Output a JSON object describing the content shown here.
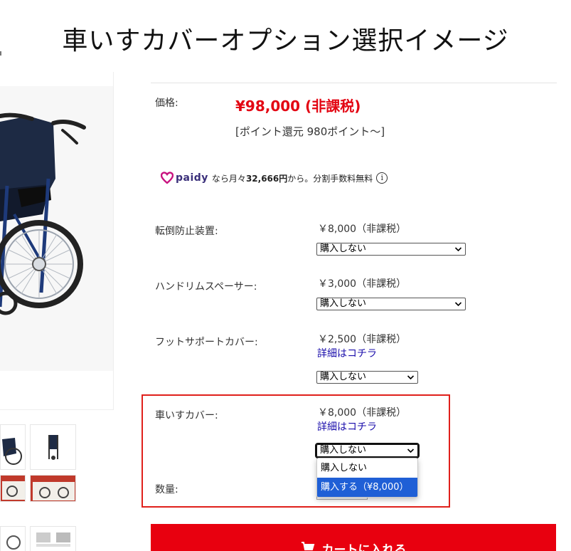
{
  "page": {
    "title": "車いすカバーオプション選択イメージ"
  },
  "product": {
    "price_label": "価格:",
    "price_value": "¥98,000 (非課税)",
    "points_text": "[ポイント還元 980ポイント〜]"
  },
  "paidy": {
    "brand": "paidy",
    "text_prefix": "なら月々",
    "monthly_amount": "32,666円",
    "text_suffix": "から。分割手数料無料",
    "info_symbol": "i"
  },
  "options": [
    {
      "label": "転倒防止装置:",
      "price": "￥8,000（非課税）",
      "select_value": "購入しない"
    },
    {
      "label": "ハンドリムスペーサー:",
      "price": "￥3,000（非課税）",
      "select_value": "購入しない"
    },
    {
      "label": "フットサポートカバー:",
      "price": "￥2,500（非課税）",
      "link_text": "詳細はコチラ",
      "select_value": "購入しない"
    },
    {
      "label": "車いすカバー:",
      "price": "￥8,000（非課税）",
      "link_text": "詳細はコチラ",
      "select_value": "購入しない",
      "dropdown_options": [
        "購入しない",
        "購入する（¥8,000）"
      ]
    }
  ],
  "quantity": {
    "label": "数量:"
  },
  "cart": {
    "label": "カートに入れる"
  },
  "colors": {
    "price_red": "#e30613",
    "highlight_border": "#e0201b",
    "link_blue": "#1a0dab",
    "dropdown_selected": "#1f5fd6",
    "cart_red": "#e8000f"
  }
}
